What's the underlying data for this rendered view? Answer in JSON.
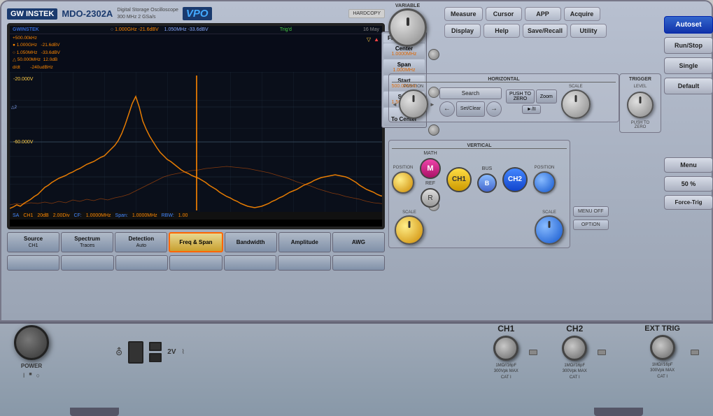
{
  "brand": {
    "logo": "GW INSTEK",
    "model": "MDO-2302A",
    "device_info_line1": "Digital Storage Oscilloscope",
    "device_info_line2": "300 MHz  2 GSa/s",
    "vpo": "VPO",
    "hardcopy": "HARDCOPY"
  },
  "screen": {
    "logo": "GWINSTEK",
    "trig_status": "Trig'd",
    "date": "16 May",
    "measurements": [
      "+500.00kHz",
      "1.000GHz   -21.6dBV",
      "1.050MHz   -33.6dBV",
      "50.000MHz  12.0dB",
      "d/dt       -240udBHz"
    ],
    "status_bar": [
      {
        "label": "SA",
        "value": "CH1"
      },
      {
        "label": "",
        "value": "20dB"
      },
      {
        "label": "",
        "value": "2.00Div"
      },
      {
        "label": "CF:",
        "value": "1.0000MHz"
      },
      {
        "label": "Span:",
        "value": "1.0000MHz"
      },
      {
        "label": "RBW:",
        "value": "1.00"
      }
    ]
  },
  "freq_span_panel": {
    "title": "Freq & Span",
    "items": [
      {
        "label": "Center",
        "value": "1.0000MHz"
      },
      {
        "label": "Span",
        "value": "1.000MHz"
      },
      {
        "label": "Start",
        "value": "500.00MHz"
      },
      {
        "label": "Stop",
        "value": "1.5000MHz"
      },
      {
        "label": "To Center",
        "value": ""
      }
    ]
  },
  "tabs": [
    {
      "label": "Source",
      "sub": "CH1",
      "active": false
    },
    {
      "label": "Spectrum",
      "sub": "Traces",
      "active": false
    },
    {
      "label": "Detection",
      "sub": "Auto",
      "active": false
    },
    {
      "label": "Freq & Span",
      "sub": "",
      "active": true
    },
    {
      "label": "Bandwidth",
      "sub": "",
      "active": false
    },
    {
      "label": "Amplitude",
      "sub": "",
      "active": false
    },
    {
      "label": "AWG",
      "sub": "",
      "active": false
    }
  ],
  "right_panel": {
    "variable_label": "VARIABLE",
    "top_buttons_row1": [
      "Measure",
      "Cursor",
      "APP",
      "Acquire"
    ],
    "top_buttons_row2": [
      "Display",
      "Help",
      "Save/Recall",
      "Utility"
    ],
    "autoset": "Autoset",
    "run_stop": "Run/Stop",
    "single": "Single",
    "default": "Default",
    "horizontal": {
      "label": "HORIZONTAL",
      "position_label": "POSITION",
      "scale_label": "SCALE",
      "search_btn": "Search",
      "set_clear_btn": "Set/Clear",
      "zoom_btn": "Zoom",
      "play_btn": "►/II"
    },
    "vertical": {
      "label": "VERTICAL",
      "position_label_left": "POSITION",
      "position_label_right": "POSITION",
      "scale_label_left": "SCALE",
      "scale_label_right": "SCALE",
      "math_label": "MATH",
      "ref_label": "REF",
      "bus_label": "BUS"
    },
    "trigger": {
      "label": "TRIGGER",
      "level_label": "LEVEL",
      "menu_btn": "Menu",
      "percent_btn": "50 %",
      "force_btn": "Force-Trig"
    },
    "menu_off": "MENU OFF",
    "option": "OPTION"
  },
  "bottom_panel": {
    "power_label": "POWER",
    "power_indicator_1": "I",
    "power_indicator_2": "○",
    "voltage_label": "2V",
    "channels": [
      {
        "label": "CH1",
        "spec1": "1MΩ//16pF",
        "spec2": "300Vpk MAX",
        "spec3": "CAT I"
      },
      {
        "label": "CH2",
        "spec1": "1MΩ//16pF",
        "spec2": "300Vpk MAX",
        "spec3": "CAT I"
      },
      {
        "label": "EXT TRIG",
        "spec1": "1MΩ//16pF",
        "spec2": "300Vpk MAX",
        "spec3": "CAT I"
      }
    ]
  }
}
